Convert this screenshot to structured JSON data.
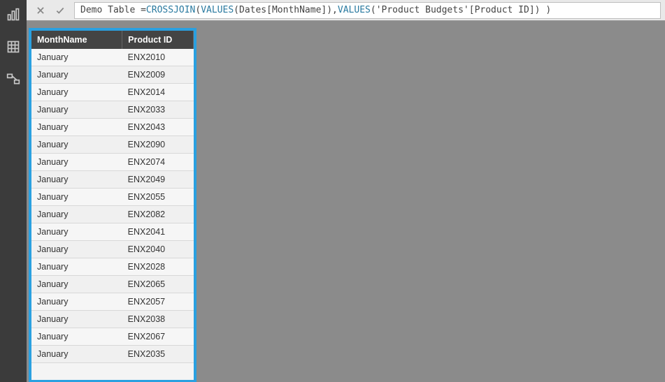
{
  "formula": {
    "prefix": "Demo Table = ",
    "kw1": "CROSSJOIN",
    "paren1": "( ",
    "kw2": "VALUES",
    "paren2": "( ",
    "ref1": "Dates[MonthName]",
    "paren3": " ), ",
    "kw3": "VALUES",
    "paren4": "( ",
    "ref2": "'Product Budgets'[Product ID]",
    "paren5": " ) )"
  },
  "table": {
    "headers": {
      "c0": "MonthName",
      "c1": "Product ID"
    },
    "rows": [
      {
        "c0": "January",
        "c1": "ENX2010"
      },
      {
        "c0": "January",
        "c1": "ENX2009"
      },
      {
        "c0": "January",
        "c1": "ENX2014"
      },
      {
        "c0": "January",
        "c1": "ENX2033"
      },
      {
        "c0": "January",
        "c1": "ENX2043"
      },
      {
        "c0": "January",
        "c1": "ENX2090"
      },
      {
        "c0": "January",
        "c1": "ENX2074"
      },
      {
        "c0": "January",
        "c1": "ENX2049"
      },
      {
        "c0": "January",
        "c1": "ENX2055"
      },
      {
        "c0": "January",
        "c1": "ENX2082"
      },
      {
        "c0": "January",
        "c1": "ENX2041"
      },
      {
        "c0": "January",
        "c1": "ENX2040"
      },
      {
        "c0": "January",
        "c1": "ENX2028"
      },
      {
        "c0": "January",
        "c1": "ENX2065"
      },
      {
        "c0": "January",
        "c1": "ENX2057"
      },
      {
        "c0": "January",
        "c1": "ENX2038"
      },
      {
        "c0": "January",
        "c1": "ENX2067"
      },
      {
        "c0": "January",
        "c1": "ENX2035"
      }
    ]
  }
}
